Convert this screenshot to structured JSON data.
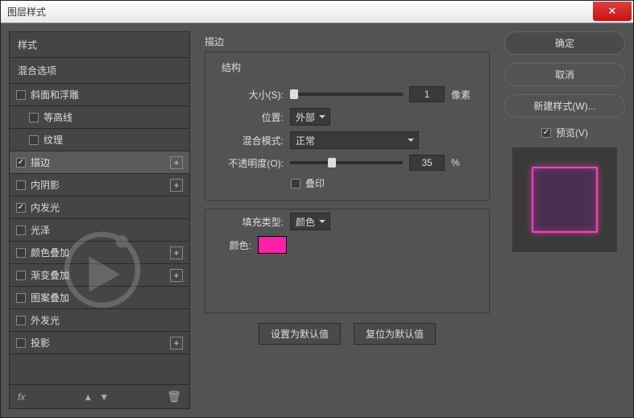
{
  "window": {
    "title": "图层样式"
  },
  "sidebar": {
    "styles_header": "样式",
    "blend_header": "混合选项",
    "items": [
      {
        "label": "斜面和浮雕",
        "checked": false,
        "plus": false,
        "indent": false
      },
      {
        "label": "等高线",
        "checked": false,
        "plus": false,
        "indent": true
      },
      {
        "label": "纹理",
        "checked": false,
        "plus": false,
        "indent": true
      },
      {
        "label": "描边",
        "checked": true,
        "plus": true,
        "indent": false,
        "selected": true
      },
      {
        "label": "内阴影",
        "checked": false,
        "plus": true,
        "indent": false
      },
      {
        "label": "内发光",
        "checked": true,
        "plus": false,
        "indent": false
      },
      {
        "label": "光泽",
        "checked": false,
        "plus": false,
        "indent": false
      },
      {
        "label": "颜色叠加",
        "checked": false,
        "plus": true,
        "indent": false
      },
      {
        "label": "渐变叠加",
        "checked": false,
        "plus": true,
        "indent": false
      },
      {
        "label": "图案叠加",
        "checked": false,
        "plus": false,
        "indent": false
      },
      {
        "label": "外发光",
        "checked": false,
        "plus": false,
        "indent": false
      },
      {
        "label": "投影",
        "checked": false,
        "plus": true,
        "indent": false
      }
    ],
    "fx_label": "fx"
  },
  "main": {
    "title": "描边",
    "structure": {
      "legend": "结构",
      "size_label": "大小(S):",
      "size_value": "1",
      "size_unit": "像素",
      "position_label": "位置:",
      "position_value": "外部",
      "blend_label": "混合模式:",
      "blend_value": "正常",
      "opacity_label": "不透明度(O):",
      "opacity_value": "35",
      "opacity_unit": "%",
      "overprint_label": "叠印"
    },
    "fill": {
      "type_label": "填充类型:",
      "type_value": "颜色",
      "color_label": "颜色:",
      "color_hex": "#ff1fa8"
    },
    "buttons": {
      "set_default": "设置为默认值",
      "reset_default": "复位为默认值"
    }
  },
  "right": {
    "ok": "确定",
    "cancel": "取消",
    "new_style": "新建样式(W)...",
    "preview": "预览(V)"
  }
}
